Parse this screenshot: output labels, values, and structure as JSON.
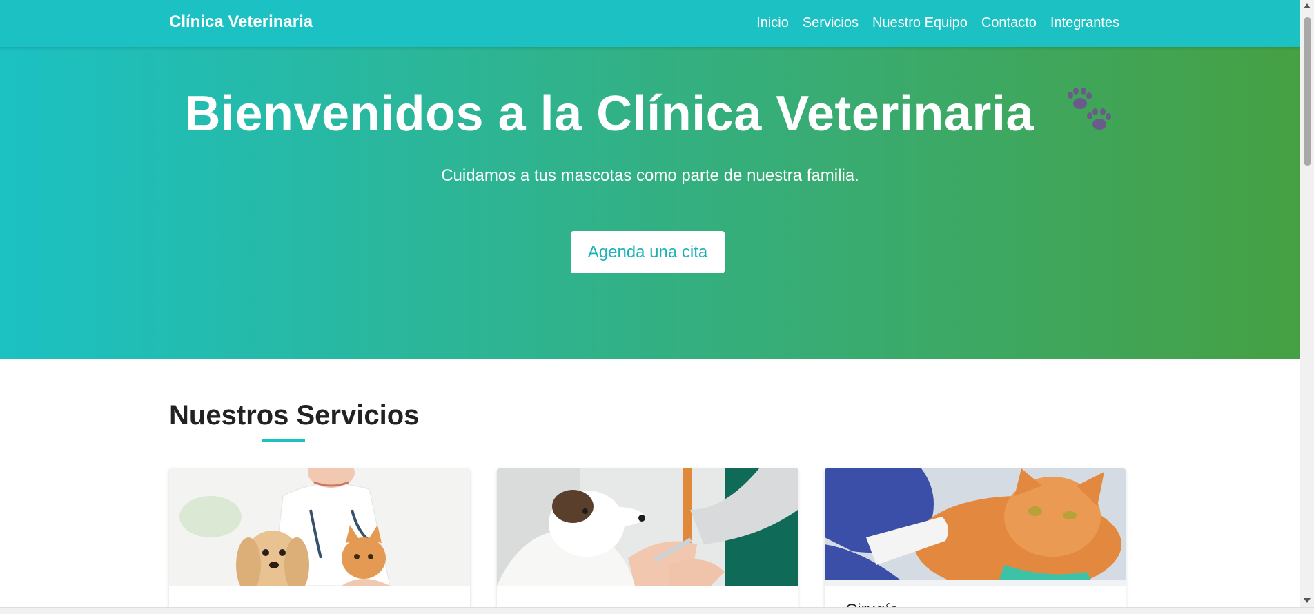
{
  "navbar": {
    "brand": "Clínica Veterinaria",
    "links": [
      "Inicio",
      "Servicios",
      "Nuestro Equipo",
      "Contacto",
      "Integrantes"
    ]
  },
  "hero": {
    "title": "Bienvenidos a la Clínica Veterinaria",
    "subtitle": "Cuidamos a tus mascotas como parte de nuestra familia.",
    "cta_label": "Agenda una cita",
    "icon": "paw-prints-icon"
  },
  "services": {
    "title": "Nuestros Servicios",
    "cards": [
      {
        "image": "vet-with-puppy-and-kitten-photo",
        "title": ""
      },
      {
        "image": "dog-receiving-injection-photo",
        "title": ""
      },
      {
        "image": "cat-with-bandaged-paw-photo",
        "title": "Cirugía"
      }
    ]
  },
  "colors": {
    "accent": "#1cc1c3",
    "gradient_end": "#46a043",
    "paw": "#6a5b8c"
  }
}
